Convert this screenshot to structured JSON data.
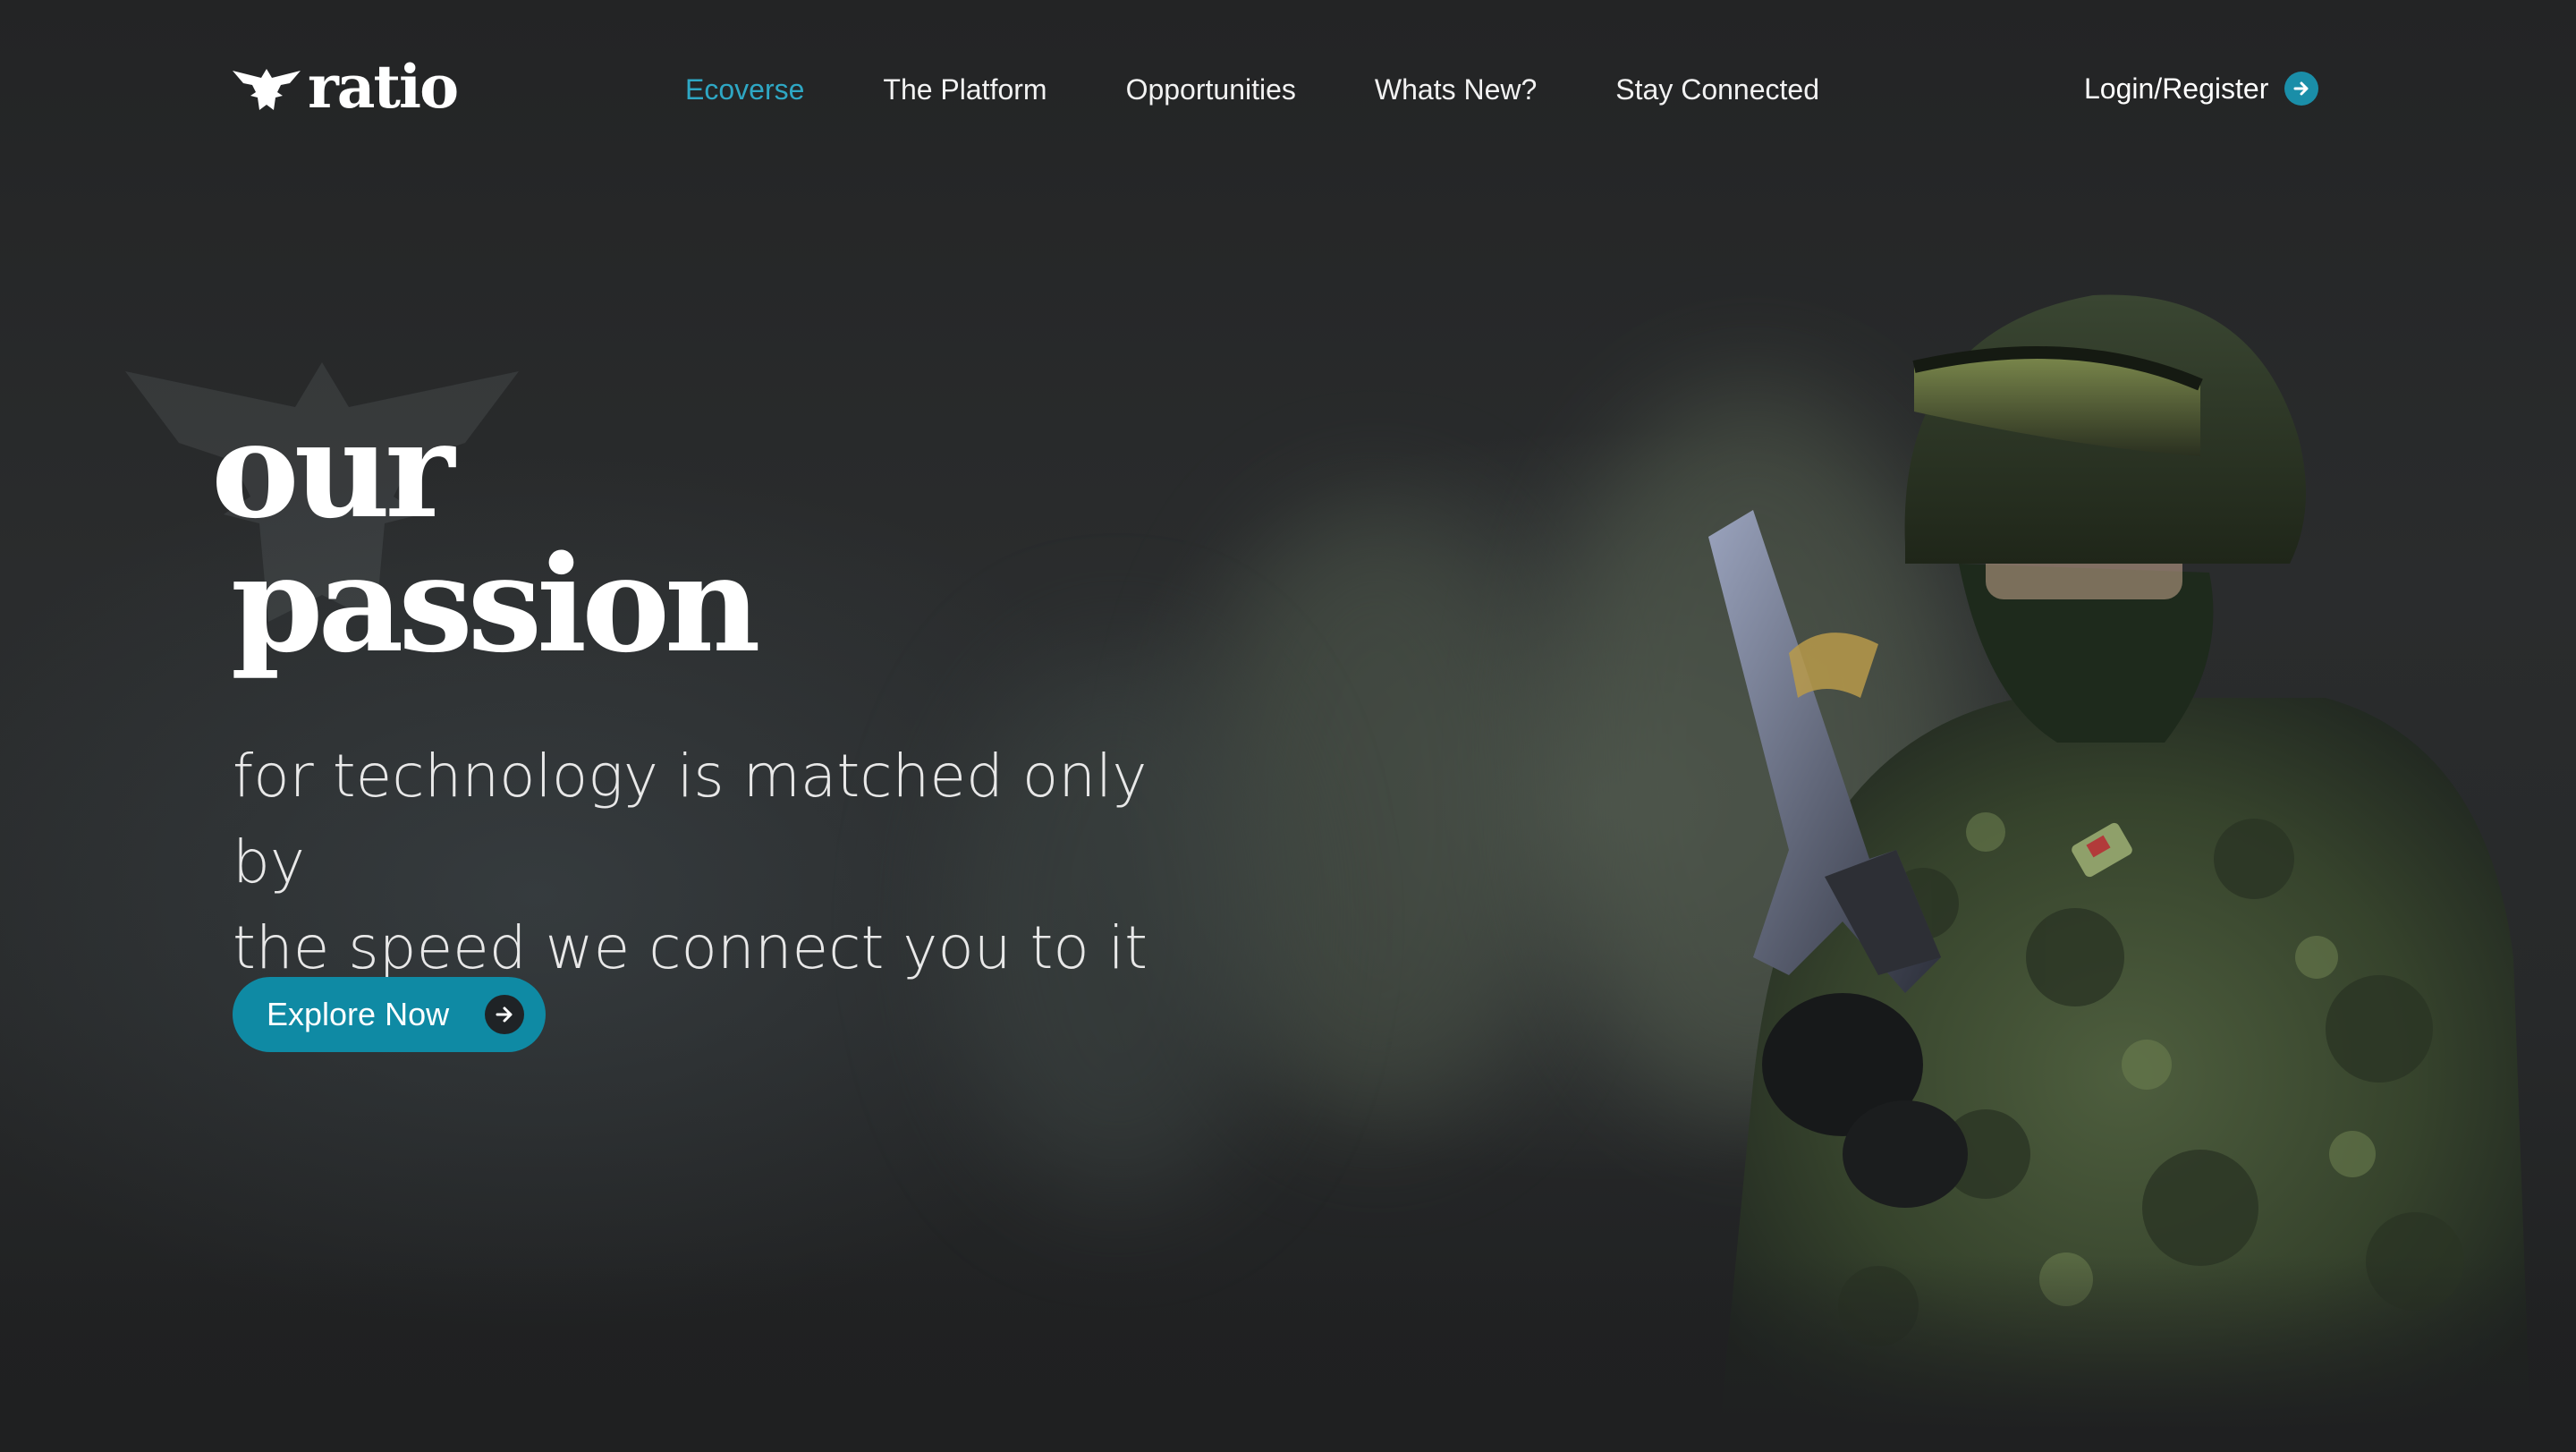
{
  "brand": {
    "name": "ratio"
  },
  "nav": {
    "items": [
      {
        "label": "Ecoverse",
        "active": true
      },
      {
        "label": "The Platform",
        "active": false
      },
      {
        "label": "Opportunities",
        "active": false
      },
      {
        "label": "Whats New?",
        "active": false
      },
      {
        "label": "Stay Connected",
        "active": false
      }
    ],
    "login_label": "Login/Register",
    "login_icon": "arrow-right-circle-icon"
  },
  "hero": {
    "headline_line1": "our",
    "headline_line2": "passion",
    "subline_line1": "for technology is matched only by",
    "subline_line2": "the speed we connect you to it",
    "cta_label": "Explore Now",
    "cta_icon": "arrow-right-circle-icon",
    "background_image": "soldier-in-camouflage-with-rifle"
  },
  "colors": {
    "accent": "#1a8ea8",
    "active_nav": "#2ea7c4",
    "background": "#1f2021",
    "text": "#ffffff"
  }
}
